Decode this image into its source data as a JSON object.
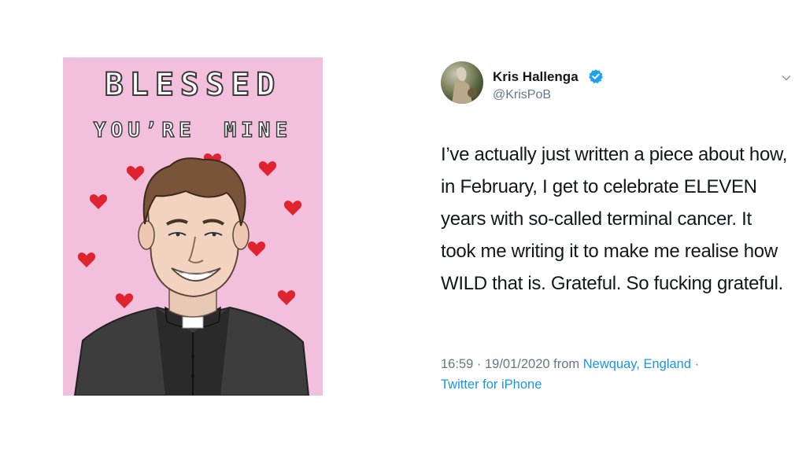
{
  "card": {
    "title": "BLESSED",
    "subtitle": "YOU’RE MINE"
  },
  "tweet": {
    "author_name": "Kris Hallenga",
    "handle": "@KrisPoB",
    "verified_icon": "verified-badge-icon",
    "menu_icon": "chevron-down-icon",
    "text": "I’ve actually just written a piece about how, in February, I get to celebrate ELEVEN years with so-called terminal cancer. It took me writing it to make me realise how WILD that is. Grateful. So fucking grateful.",
    "time": "16:59",
    "separator": " · ",
    "date": "19/01/2020",
    "from_label": " from ",
    "location": "Newquay, England",
    "source": "Twitter for iPhone"
  },
  "colors": {
    "card_background": "#f2bfdc",
    "heart": "#e0242f",
    "link": "#1b95e0",
    "verified": "#1da1f2",
    "meta_text": "#657786"
  }
}
